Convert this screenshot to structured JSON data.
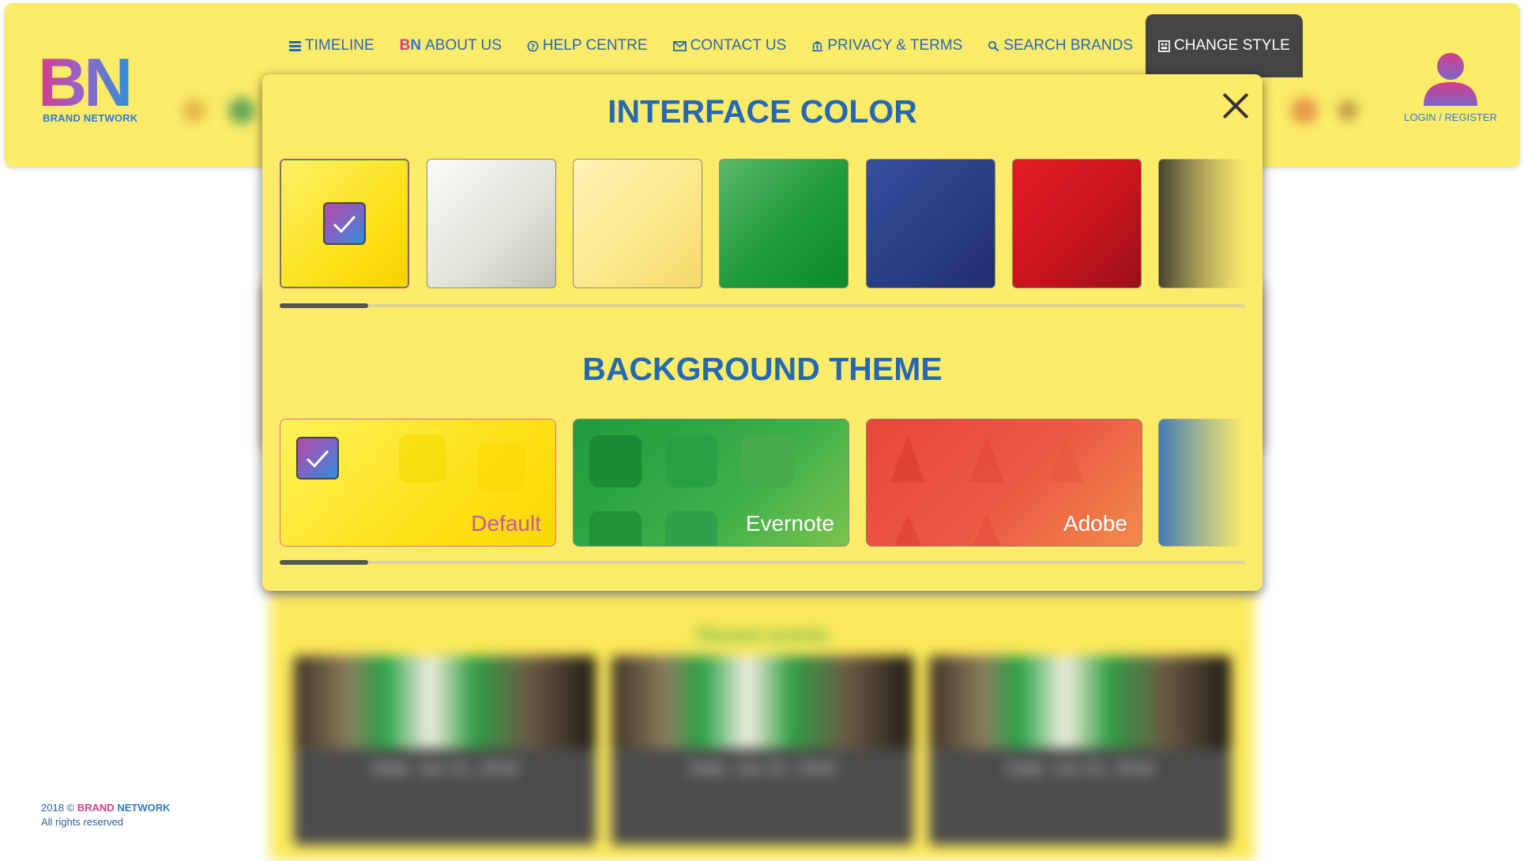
{
  "header": {
    "logo_letters": "BN",
    "logo_text": "BRAND NETWORK",
    "nav": [
      {
        "label": "TIMELINE",
        "icon": "list-icon"
      },
      {
        "label": "ABOUT US",
        "icon": "bn-mini-logo",
        "prefix": "BN"
      },
      {
        "label": "HELP CENTRE",
        "icon": "question-circle-icon"
      },
      {
        "label": "CONTACT US",
        "icon": "envelope-icon"
      },
      {
        "label": "PRIVACY & TERMS",
        "icon": "bank-icon"
      },
      {
        "label": "SEARCH BRANDS",
        "icon": "search-icon"
      },
      {
        "label": "CHANGE STYLE",
        "icon": "palette-icon",
        "active": true
      }
    ],
    "user": {
      "label": "LOGIN / REGISTER",
      "icon": "user-icon"
    }
  },
  "modal": {
    "interface_title": "INTERFACE COLOR",
    "interface_colors": [
      {
        "name": "yellow",
        "color": "#fde21a",
        "selected": true
      },
      {
        "name": "silver",
        "color": "#e2e2da",
        "selected": false
      },
      {
        "name": "light-yellow",
        "color": "#fde98c",
        "selected": false
      },
      {
        "name": "green",
        "color": "#1e9a3c",
        "selected": false
      },
      {
        "name": "navy",
        "color": "#2a3d86",
        "selected": false
      },
      {
        "name": "red",
        "color": "#c8141e",
        "selected": false
      },
      {
        "name": "black",
        "color": "#333333",
        "selected": false
      }
    ],
    "background_title": "BACKGROUND THEME",
    "themes": [
      {
        "label": "Default",
        "selected": true
      },
      {
        "label": "Evernote",
        "selected": false
      },
      {
        "label": "Adobe",
        "selected": false
      },
      {
        "label": "",
        "selected": false
      }
    ]
  },
  "background_page": {
    "section_title": "Recent events",
    "cards": [
      {
        "caption": "Date: Jun 01, 2018"
      },
      {
        "caption": "Date: Jun 01, 2018"
      },
      {
        "caption": "Date: Jun 01, 2018"
      }
    ]
  },
  "footer": {
    "year": "2018 ©",
    "brand_a": "BRAND",
    "brand_b": "NETWORK",
    "rights": "All rights reserved"
  },
  "colors": {
    "header_bg": "#fcec6a",
    "accent_blue": "#2568b3",
    "accent_pink": "#d63c8f",
    "active_tab_bg": "#444444"
  }
}
